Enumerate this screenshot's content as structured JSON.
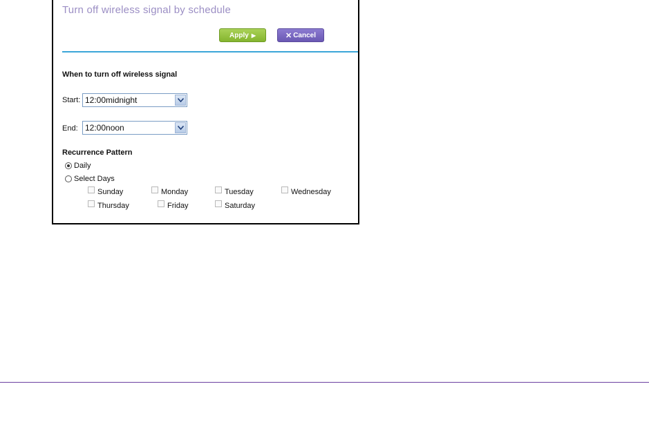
{
  "title": "Turn off wireless signal by schedule",
  "buttons": {
    "apply_label": "Apply",
    "cancel_label": "Cancel"
  },
  "section_when": "When to turn off wireless signal",
  "start": {
    "label": "Start:",
    "value": "12:00midnight"
  },
  "end": {
    "label": "End:",
    "value": "12:00noon"
  },
  "recurrence": {
    "title": "Recurrence Pattern",
    "daily_label": "Daily",
    "select_days_label": "Select Days",
    "selected": "Daily"
  },
  "days": {
    "sunday": "Sunday",
    "monday": "Monday",
    "tuesday": "Tuesday",
    "wednesday": "Wednesday",
    "thursday": "Thursday",
    "friday": "Friday",
    "saturday": "Saturday"
  },
  "colors": {
    "title": "#9b8ec4",
    "apply_button": "#8fbf36",
    "cancel_button": "#7463c1",
    "divider": "#3aa6d8",
    "bottom_rule": "#6b3fa0"
  }
}
